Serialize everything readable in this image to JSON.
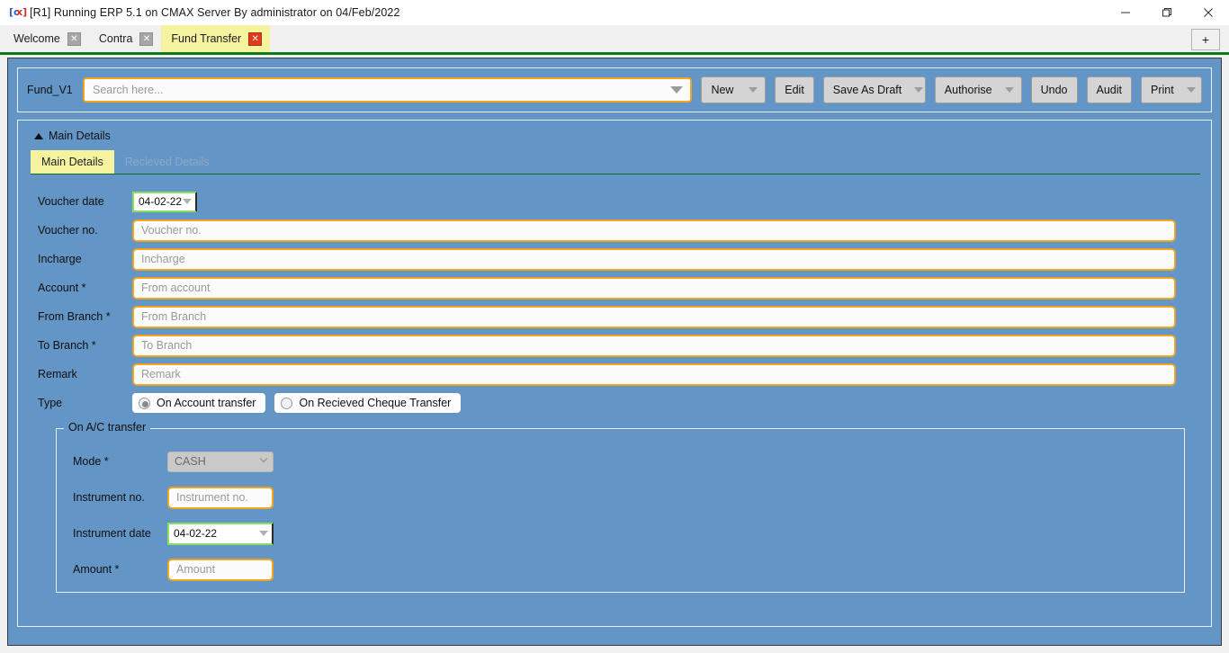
{
  "window": {
    "title": "[R1] Running ERP 5.1 on CMAX Server By administrator on 04/Feb/2022",
    "icon": "app-icon",
    "minimize": "—",
    "maximize": "❐",
    "close": "✕"
  },
  "tabbar": {
    "tabs": [
      {
        "label": "Welcome",
        "close": "✕",
        "active": false
      },
      {
        "label": "Contra",
        "close": "✕",
        "active": false
      },
      {
        "label": "Fund Transfer",
        "close": "✕",
        "active": true
      }
    ],
    "add_tab_label": "+"
  },
  "toolbar": {
    "form_code": "Fund_V1",
    "search_placeholder": "Search here...",
    "search_value": "",
    "buttons": [
      {
        "label": "New",
        "has_dropdown": true
      },
      {
        "label": "Edit",
        "has_dropdown": false
      },
      {
        "label": "Save As Draft",
        "has_dropdown": true
      },
      {
        "label": "Authorise",
        "has_dropdown": true
      },
      {
        "label": "Undo",
        "has_dropdown": false
      },
      {
        "label": "Audit",
        "has_dropdown": false
      },
      {
        "label": "Print",
        "has_dropdown": true
      }
    ]
  },
  "section": {
    "header": "Main Details",
    "collapse_icon": "triangle-up",
    "subtabs": [
      {
        "label": "Main Details",
        "active": true
      },
      {
        "label": "Recieved Details",
        "active": false
      }
    ]
  },
  "form": {
    "voucher_date": {
      "label": "Voucher date",
      "value": "04-02-22"
    },
    "voucher_no": {
      "label": "Voucher no.",
      "placeholder": "Voucher no.",
      "value": ""
    },
    "incharge": {
      "label": "Incharge",
      "placeholder": "Incharge",
      "value": ""
    },
    "account": {
      "label": "Account *",
      "placeholder": "From account",
      "value": ""
    },
    "from_branch": {
      "label": "From Branch *",
      "placeholder": "From Branch",
      "value": ""
    },
    "to_branch": {
      "label": "To Branch *",
      "placeholder": "To Branch",
      "value": ""
    },
    "remark": {
      "label": "Remark",
      "placeholder": "Remark",
      "value": ""
    },
    "type": {
      "label": "Type",
      "options": [
        {
          "label": "On Account transfer",
          "selected": true
        },
        {
          "label": "On Recieved Cheque Transfer",
          "selected": false
        }
      ]
    }
  },
  "fieldset": {
    "legend": "On A/C transfer",
    "mode": {
      "label": "Mode *",
      "value": "CASH",
      "disabled": true
    },
    "instrument_no": {
      "label": "Instrument no.",
      "placeholder": "Instrument no.",
      "value": ""
    },
    "instrument_date": {
      "label": "Instrument date",
      "value": "04-02-22"
    },
    "amount": {
      "label": "Amount *",
      "placeholder": "Amount",
      "value": ""
    }
  },
  "colors": {
    "background_blue": "#6395c6",
    "accent_orange": "#efa61e",
    "active_tab_yellow": "#f5f3a0",
    "tab_underline_green": "#0c7a19",
    "focus_green": "#86e05a",
    "close_red": "#e03a1a"
  }
}
